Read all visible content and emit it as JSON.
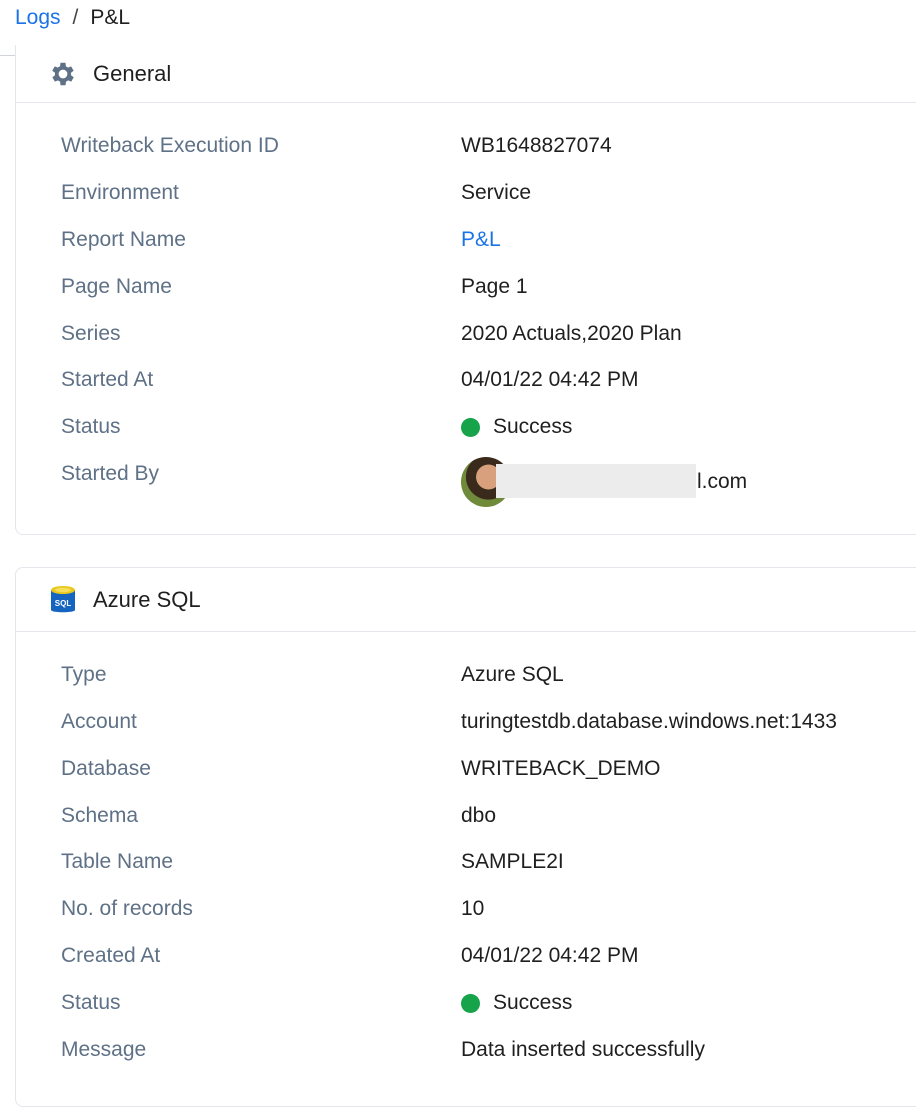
{
  "breadcrumb": {
    "parent": "Logs",
    "separator": "/",
    "current": "P&L"
  },
  "general": {
    "title": "General",
    "icon": "gear-icon",
    "rows": [
      {
        "label": "Writeback Execution ID",
        "value": "WB1648827074"
      },
      {
        "label": "Environment",
        "value": "Service"
      },
      {
        "label": "Report Name",
        "value": "P&L"
      },
      {
        "label": "Page Name",
        "value": "Page 1"
      },
      {
        "label": "Series",
        "value": "2020 Actuals,2020 Plan"
      },
      {
        "label": "Started At",
        "value": "04/01/22 04:42 PM"
      },
      {
        "label": "Status",
        "value": "Success"
      },
      {
        "label": "Started By",
        "value": "l.com"
      }
    ]
  },
  "destination": {
    "title": "Azure SQL",
    "icon": "azure-sql-database-icon",
    "icon_text": "SQL",
    "rows": [
      {
        "label": "Type",
        "value": "Azure SQL"
      },
      {
        "label": "Account",
        "value": "turingtestdb.database.windows.net:1433"
      },
      {
        "label": "Database",
        "value": "WRITEBACK_DEMO"
      },
      {
        "label": "Schema",
        "value": "dbo"
      },
      {
        "label": "Table Name",
        "value": "SAMPLE2I"
      },
      {
        "label": "No. of records",
        "value": "10"
      },
      {
        "label": "Created At",
        "value": "04/01/22 04:42 PM"
      },
      {
        "label": "Status",
        "value": "Success"
      },
      {
        "label": "Message",
        "value": "Data inserted successfully"
      }
    ]
  },
  "colors": {
    "link": "#1a73e8",
    "label": "#5f7186",
    "success": "#16a34a"
  }
}
